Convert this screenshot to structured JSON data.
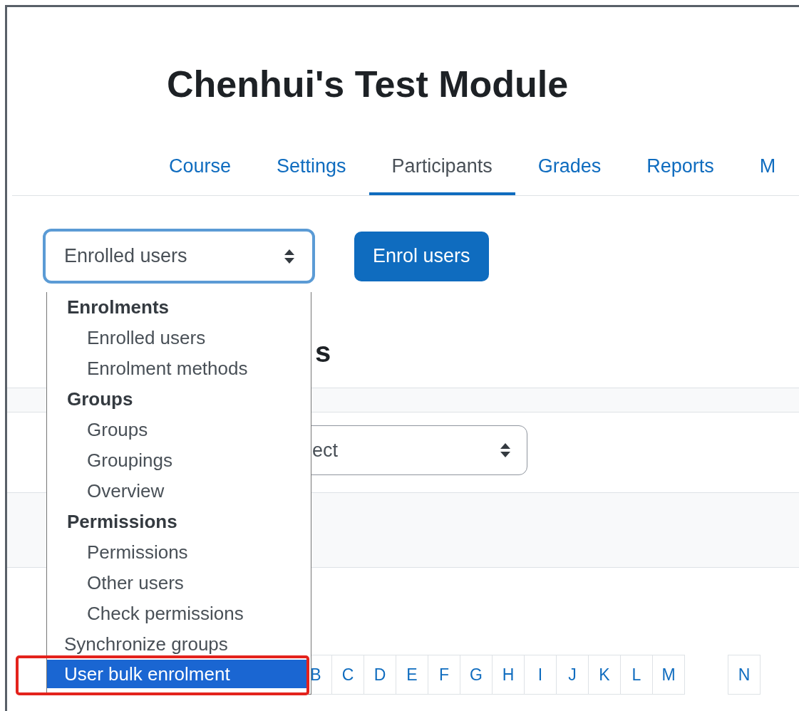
{
  "page": {
    "title": "Chenhui's Test Module"
  },
  "tabs": [
    {
      "label": "Course",
      "selected": false
    },
    {
      "label": "Settings",
      "selected": false
    },
    {
      "label": "Participants",
      "selected": true
    },
    {
      "label": "Grades",
      "selected": false
    },
    {
      "label": "Reports",
      "selected": false
    },
    {
      "label": "M",
      "selected": false
    }
  ],
  "enrol_select": {
    "value": "Enrolled users",
    "expanded": true
  },
  "enrol_button": {
    "label": "Enrol users"
  },
  "menu": [
    {
      "kind": "group",
      "label": "Enrolments",
      "children": [
        {
          "label": "Enrolled users",
          "selected": false
        },
        {
          "label": "Enrolment methods",
          "selected": false
        }
      ]
    },
    {
      "kind": "group",
      "label": "Groups",
      "children": [
        {
          "label": "Groups",
          "selected": false
        },
        {
          "label": "Groupings",
          "selected": false
        },
        {
          "label": "Overview",
          "selected": false
        }
      ]
    },
    {
      "kind": "group",
      "label": "Permissions",
      "children": [
        {
          "label": "Permissions",
          "selected": false
        },
        {
          "label": "Other users",
          "selected": false
        },
        {
          "label": "Check permissions",
          "selected": false
        }
      ]
    },
    {
      "kind": "option",
      "label": "Synchronize groups",
      "selected": false
    },
    {
      "kind": "option",
      "label": "User bulk enrolment",
      "selected": true
    }
  ],
  "heading_fragment": "s",
  "filter_select": {
    "value": "ect"
  },
  "initials": [
    "B",
    "C",
    "D",
    "E",
    "F",
    "G",
    "H",
    "I",
    "J",
    "K",
    "L",
    "M"
  ],
  "initials_second": [
    "N"
  ]
}
